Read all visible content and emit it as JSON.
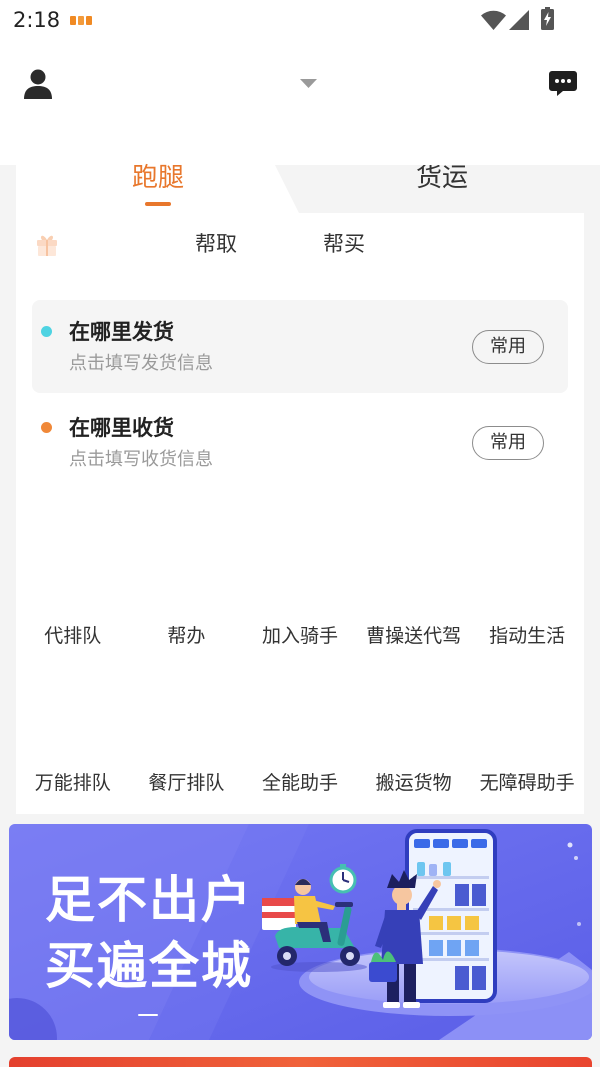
{
  "status_bar": {
    "time": "2:18",
    "icons": {
      "notification": "app-notification-icon",
      "wifi": "wifi-icon",
      "signal": "cellular-signal-icon",
      "battery": "battery-charging-icon"
    }
  },
  "header": {
    "icons": {
      "profile": "user-icon",
      "dropdown": "chevron-down-icon",
      "messages": "message-icon"
    }
  },
  "service_tabs": [
    {
      "label": "跑腿",
      "active": true
    },
    {
      "label": "货运",
      "active": false
    }
  ],
  "sub_tabs": {
    "icon": "gift-box-icon",
    "items": [
      {
        "label": "帮取"
      },
      {
        "label": "帮买"
      }
    ]
  },
  "addresses": [
    {
      "title": "在哪里发货",
      "hint": "点击填写发货信息",
      "button_label": "常用",
      "dot_color": "#4ed3e2"
    },
    {
      "title": "在哪里收货",
      "hint": "点击填写收货信息",
      "button_label": "常用",
      "dot_color": "#f08838"
    }
  ],
  "services": [
    {
      "label": "代排队"
    },
    {
      "label": "帮办"
    },
    {
      "label": "加入骑手"
    },
    {
      "label": "曹操送代驾"
    },
    {
      "label": "指动生活"
    },
    {
      "label": "万能排队"
    },
    {
      "label": "餐厅排队"
    },
    {
      "label": "全能助手"
    },
    {
      "label": "搬运货物"
    },
    {
      "label": "无障碍助手"
    }
  ],
  "banner": {
    "lines": [
      "足不出户",
      "买遍全城"
    ]
  },
  "colors": {
    "accent": "#e8772c",
    "banner": "#6468ee",
    "promo_banner": "#e9432f"
  }
}
